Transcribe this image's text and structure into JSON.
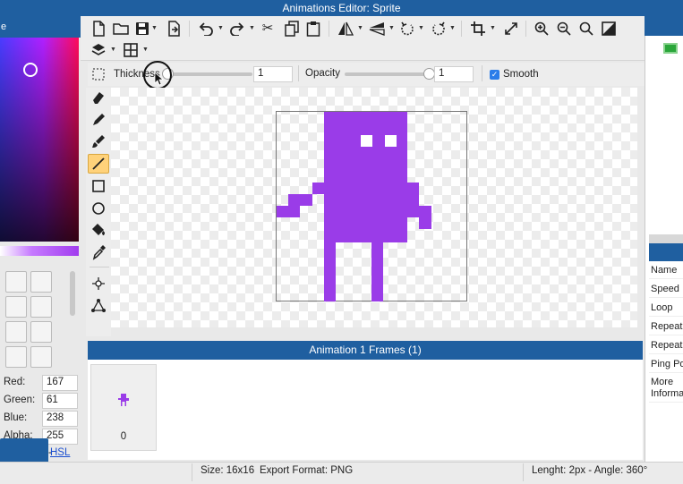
{
  "window": {
    "title": "Animations Editor: Sprite"
  },
  "left_panel": {
    "header_label": "e",
    "rgb": [
      {
        "label": "Red:",
        "value": "167"
      },
      {
        "label": "Green:",
        "value": "61"
      },
      {
        "label": "Blue:",
        "value": "238"
      },
      {
        "label": "Alpha:",
        "value": "255"
      }
    ],
    "hsl_link": "HSL",
    "dash": "-",
    "current_color": "#1f5fa0"
  },
  "toolbar": {
    "icons": [
      "new-file",
      "open-folder",
      "save",
      "export",
      "undo",
      "redo",
      "cut",
      "copy",
      "paste",
      "flip-horizontal",
      "flip-vertical",
      "rotate-left",
      "rotate-right",
      "crop",
      "resize",
      "zoom-in",
      "zoom-out",
      "zoom-fit",
      "invert",
      "layers",
      "grid"
    ]
  },
  "options": {
    "thickness_label": "Thickness",
    "thickness_value": "1",
    "opacity_label": "Opacity",
    "opacity_value": "1",
    "smooth_label": "Smooth",
    "smooth_checked": true
  },
  "tools": [
    "eraser",
    "pencil",
    "brush",
    "line",
    "rectangle",
    "ellipse",
    "fill-bucket",
    "eyedropper",
    "move-point",
    "shape-points"
  ],
  "active_tool": "line",
  "sprite": {
    "color": "#9a3ce8"
  },
  "frames": {
    "header": "Animation 1 Frames (1)",
    "items": [
      {
        "label": "0"
      }
    ]
  },
  "properties": [
    "Name",
    "Speed",
    "Loop",
    "Repeat",
    "Repeat",
    "Ping Po",
    "More Informa"
  ],
  "status": {
    "size": "Size: 16x16",
    "export_format": "Export Format: PNG",
    "length_angle": "Lenght: 2px - Angle: 360°"
  }
}
